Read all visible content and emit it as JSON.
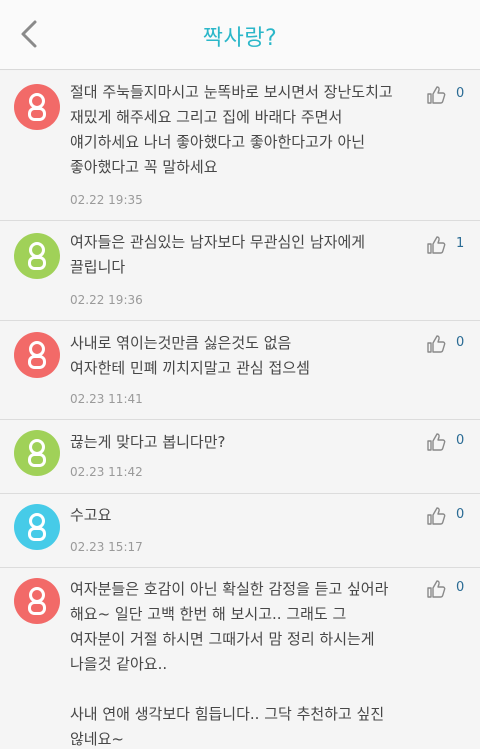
{
  "header": {
    "title": "짝사랑?",
    "back_icon": "chevron-left-icon",
    "title_color": "#2bb7c9"
  },
  "colors": {
    "avatar_red": "#f26a68",
    "avatar_green": "#a0d158",
    "avatar_blue": "#46cbe8",
    "like_count": "#2a6b94"
  },
  "comments": [
    {
      "avatar_color": "red",
      "text": "절대 주눅들지마시고 눈똑바로 보시면서 장난도치고\n재밌게 해주세요  그리고 집에 바래다 주면서\n얘기하세요 나너 좋아했다고 좋아한다고가 아닌\n좋아했다고 꼭 말하세요",
      "time": "02.22 19:35",
      "likes": "0"
    },
    {
      "avatar_color": "green",
      "text": "여자들은 관심있는 남자보다 무관심인 남자에게\n끌립니다",
      "time": "02.22 19:36",
      "likes": "1"
    },
    {
      "avatar_color": "red",
      "text": "사내로 엮이는것만큼 싫은것도 없음\n여자한테 민폐 끼치지말고 관심 접으셈",
      "time": "02.23 11:41",
      "likes": "0"
    },
    {
      "avatar_color": "green",
      "text": "끊는게 맞다고 봅니다만?",
      "time": "02.23 11:42",
      "likes": "0"
    },
    {
      "avatar_color": "blue",
      "text": "수고요",
      "time": "02.23 15:17",
      "likes": "0"
    },
    {
      "avatar_color": "red",
      "text": "여자분들은 호감이 아닌 확실한 감정을 듣고 싶어라\n해요~  일단 고백 한번 해 보시고..  그래도 그\n여자분이 거절 하시면 그때가서 맘 정리 하시는게\n나을것 같아요..\n\n사내 연애 생각보다 힘듭니다..  그닥 추천하고 싶진\n않네요~",
      "time": "",
      "likes": "0"
    }
  ]
}
